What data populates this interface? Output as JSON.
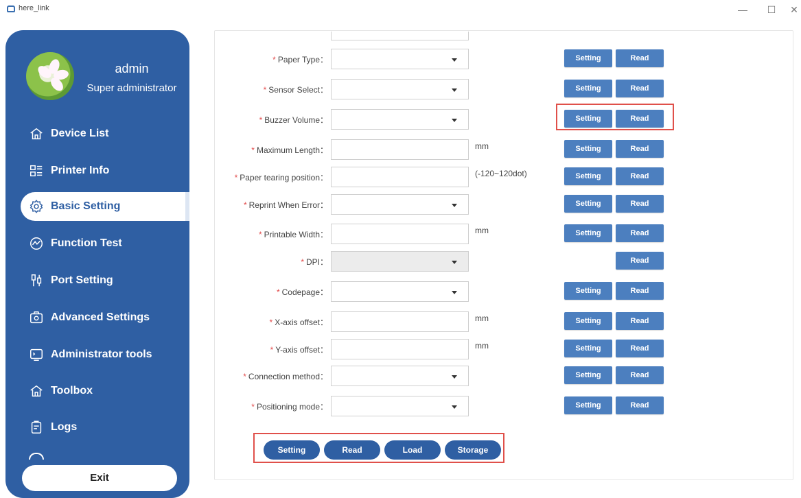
{
  "window": {
    "title": "here_link",
    "minimize_glyph": "—",
    "maximize_glyph": "☐",
    "close_glyph": "✕"
  },
  "user": {
    "name": "admin",
    "role": "Super administrator"
  },
  "nav": [
    {
      "label": "Device List",
      "icon": "home-icon"
    },
    {
      "label": "Printer Info",
      "icon": "list-grid-icon"
    },
    {
      "label": "Basic Setting",
      "icon": "gear-icon",
      "active": true
    },
    {
      "label": "Function Test",
      "icon": "chart-line-icon"
    },
    {
      "label": "Port Setting",
      "icon": "port-icon"
    },
    {
      "label": "Advanced Settings",
      "icon": "camera-box-icon"
    },
    {
      "label": "Administrator tools",
      "icon": "terminal-icon"
    },
    {
      "label": "Toolbox",
      "icon": "home-icon"
    },
    {
      "label": "Logs",
      "icon": "clipboard-icon"
    }
  ],
  "exit_label": "Exit",
  "form": {
    "rows": [
      {
        "label": "Paper Type：",
        "type": "select",
        "setting": "Setting",
        "read": "Read"
      },
      {
        "label": "Sensor Select：",
        "type": "select",
        "setting": "Setting",
        "read": "Read"
      },
      {
        "label": "Buzzer Volume：",
        "type": "select",
        "setting": "Setting",
        "read": "Read"
      },
      {
        "label": "Maximum Length：",
        "type": "input",
        "unit": "mm",
        "setting": "Setting",
        "read": "Read"
      },
      {
        "label": "Paper tearing position：",
        "type": "input",
        "unit": "(-120~120dot)",
        "setting": "Setting",
        "read": "Read"
      },
      {
        "label": "Reprint When Error：",
        "type": "select",
        "setting": "Setting",
        "read": "Read"
      },
      {
        "label": "Printable Width：",
        "type": "input",
        "unit": "mm",
        "setting": "Setting",
        "read": "Read"
      },
      {
        "label": "DPI：",
        "type": "select-disabled",
        "read": "Read"
      },
      {
        "label": "Codepage：",
        "type": "select",
        "setting": "Setting",
        "read": "Read"
      },
      {
        "label": "X-axis offset：",
        "type": "input",
        "unit": "mm",
        "setting": "Setting",
        "read": "Read"
      },
      {
        "label": "Y-axis offset：",
        "type": "input",
        "unit": "mm",
        "setting": "Setting",
        "read": "Read"
      },
      {
        "label": "Connection method：",
        "type": "select",
        "setting": "Setting",
        "read": "Read"
      },
      {
        "label": "Positioning mode：",
        "type": "select",
        "setting": "Setting",
        "read": "Read"
      }
    ],
    "required_mark": "*"
  },
  "bottom_buttons": [
    "Setting",
    "Read",
    "Load",
    "Storage"
  ],
  "colors": {
    "sidebar": "#2f5fa3",
    "button": "#4c7fbf",
    "highlight": "#e0504a",
    "required": "#e24b4b"
  }
}
